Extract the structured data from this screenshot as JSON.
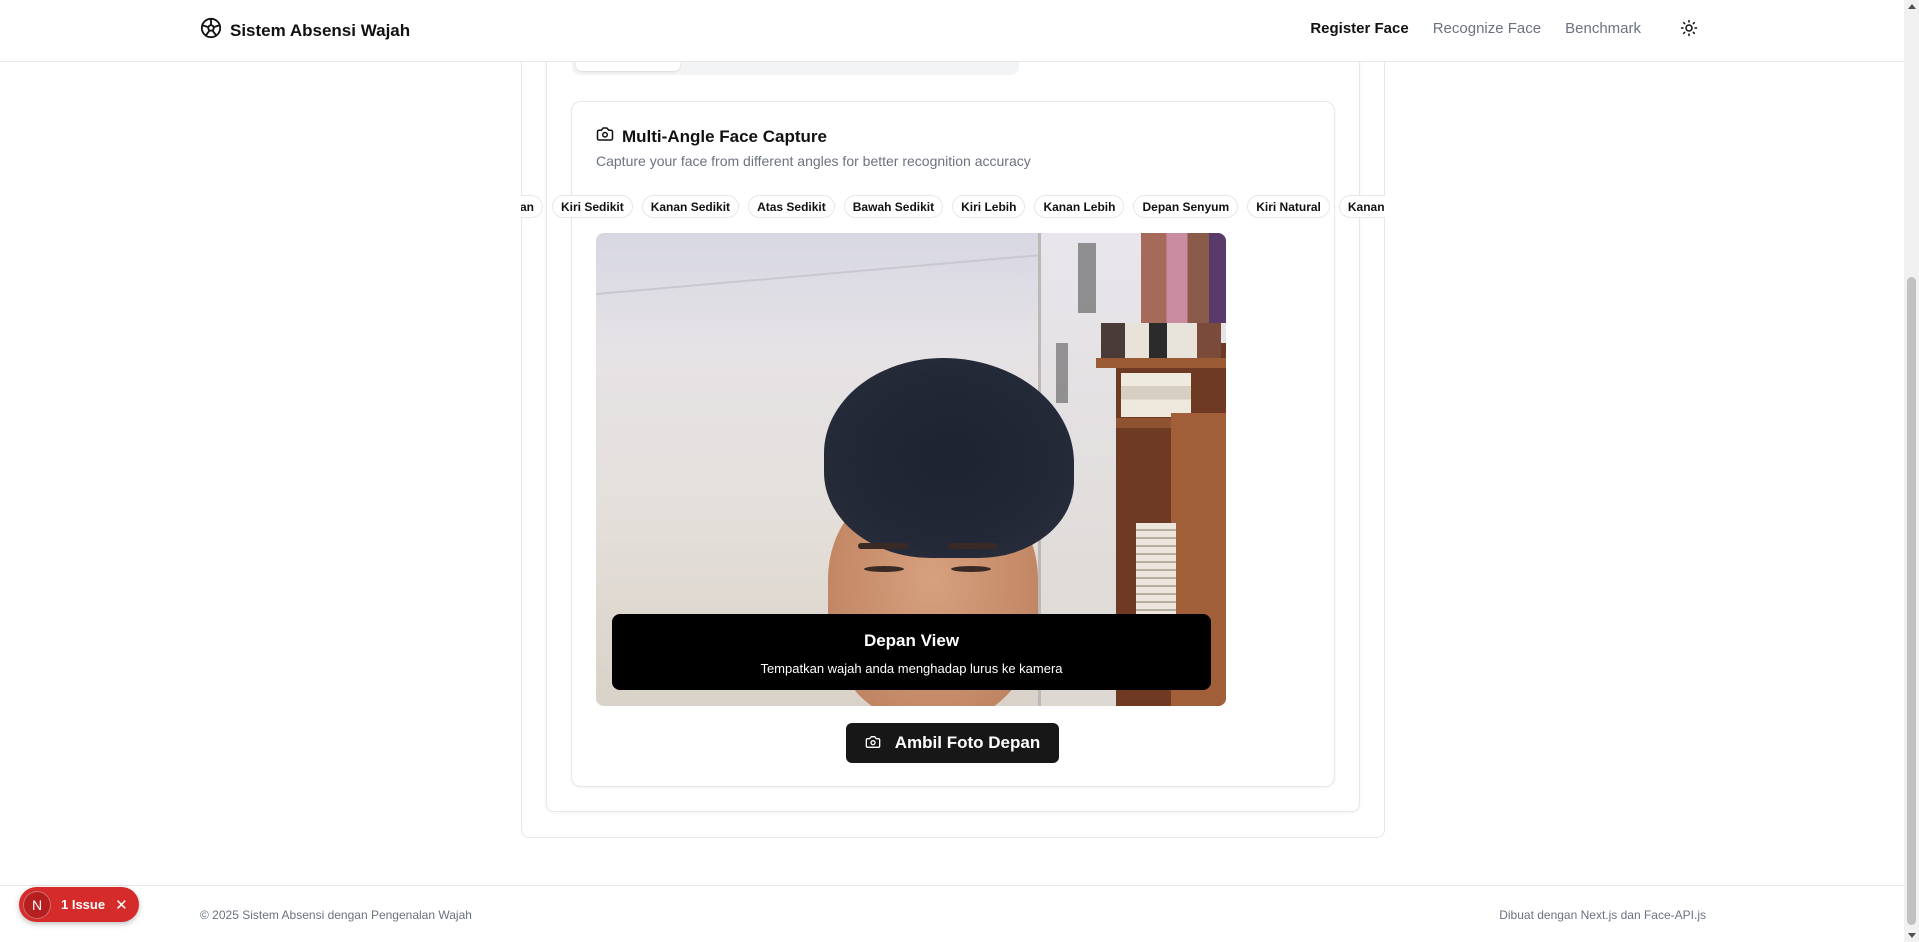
{
  "header": {
    "brand_title": "Sistem Absensi Wajah",
    "brand_icon": "aperture-icon",
    "nav": [
      {
        "label": "Register Face",
        "active": true
      },
      {
        "label": "Recognize Face",
        "active": false
      },
      {
        "label": "Benchmark",
        "active": false
      }
    ],
    "theme_icon": "sun-icon"
  },
  "capture": {
    "title": "Multi-Angle Face Capture",
    "title_icon": "camera-icon",
    "description": "Capture your face from different angles for better recognition accuracy",
    "angles": [
      "epan",
      "Kiri Sedikit",
      "Kanan Sedikit",
      "Atas Sedikit",
      "Bawah Sedikit",
      "Kiri Lebih",
      "Kanan Lebih",
      "Depan Senyum",
      "Kiri Natural",
      "Kanan Natur"
    ],
    "overlay_title": "Depan View",
    "overlay_subtitle": "Tempatkan wajah anda menghadap lurus ke kamera",
    "button_label": "Ambil Foto Depan",
    "button_icon": "camera-icon"
  },
  "footer": {
    "left": "© 2025 Sistem Absensi dengan Pengenalan Wajah",
    "right": "Dibuat dengan Next.js dan Face-API.js"
  },
  "issue_badge": {
    "logo": "N",
    "label": "1 Issue",
    "close_icon": "close-icon"
  },
  "colors": {
    "primary_button": "#171717",
    "issue_red": "#d52b2b",
    "muted_text": "#6b7280",
    "border": "#e5e7eb"
  }
}
